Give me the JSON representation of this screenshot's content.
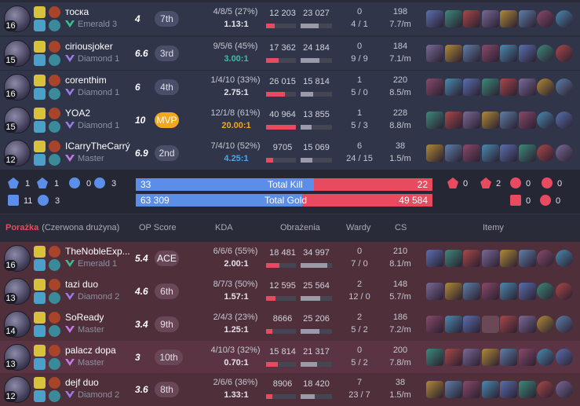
{
  "team_blue": {
    "players": [
      {
        "name": "тоска",
        "level": "16",
        "rank": "Emerald 3",
        "rank_color": "#36c28c",
        "op_score": "4",
        "placement": "7th",
        "placement_style": "normal",
        "kda_line": "4/8/5 (27%)",
        "kda_ratio": "1.13:1",
        "kda_color": "#e4e4ea",
        "damage_dealt": "12 203",
        "damage_taken": "23 027",
        "damage_dealt_pct": 0.29,
        "damage_taken_pct": 0.57,
        "wards_placed": "0",
        "wards_line": "4 / 1",
        "cs": "198",
        "cs_per_min": "7.7/m"
      },
      {
        "name": "ciriousjoker",
        "level": "15",
        "rank": "Diamond 1",
        "rank_color": "#9a7be8",
        "op_score": "6.6",
        "placement": "3rd",
        "placement_style": "normal",
        "kda_line": "9/5/6 (45%)",
        "kda_ratio": "3.00:1",
        "kda_color": "#2ec4a6",
        "damage_dealt": "17 362",
        "damage_taken": "24 184",
        "damage_dealt_pct": 0.42,
        "damage_taken_pct": 0.6,
        "wards_placed": "0",
        "wards_line": "9 / 9",
        "cs": "184",
        "cs_per_min": "7.1/m"
      },
      {
        "name": "corenthim",
        "level": "16",
        "rank": "Diamond 1",
        "rank_color": "#9a7be8",
        "op_score": "6",
        "placement": "4th",
        "placement_style": "normal",
        "kda_line": "1/4/10 (33%)",
        "kda_ratio": "2.75:1",
        "kda_color": "#e4e4ea",
        "damage_dealt": "26 015",
        "damage_taken": "15 814",
        "damage_dealt_pct": 0.64,
        "damage_taken_pct": 0.39,
        "wards_placed": "1",
        "wards_line": "5 / 0",
        "cs": "220",
        "cs_per_min": "8.5/m"
      },
      {
        "name": "YOA2",
        "level": "15",
        "rank": "Diamond 1",
        "rank_color": "#9a7be8",
        "op_score": "10",
        "placement": "MVP",
        "placement_style": "mvp",
        "kda_line": "12/1/8 (61%)",
        "kda_ratio": "20.00:1",
        "kda_color": "#f0a81e",
        "damage_dealt": "40 964",
        "damage_taken": "13 855",
        "damage_dealt_pct": 1.0,
        "damage_taken_pct": 0.34,
        "wards_placed": "1",
        "wards_line": "5 / 3",
        "cs": "228",
        "cs_per_min": "8.8/m"
      },
      {
        "name": "ICarryTheCarrý",
        "level": "12",
        "rank": "Master",
        "rank_color": "#c47ae8",
        "op_score": "6.9",
        "placement": "2nd",
        "placement_style": "normal",
        "kda_line": "7/4/10 (52%)",
        "kda_ratio": "4.25:1",
        "kda_color": "#4aa8f0",
        "damage_dealt": "9705",
        "damage_taken": "15 069",
        "damage_dealt_pct": 0.24,
        "damage_taken_pct": 0.37,
        "wards_placed": "6",
        "wards_line": "24 / 15",
        "cs": "38",
        "cs_per_min": "1.5/m"
      }
    ]
  },
  "summary": {
    "blue_objectives": [
      "1",
      "1",
      "0",
      "3"
    ],
    "blue_objectives_row2": [
      "11",
      "3"
    ],
    "red_objectives": [
      "0",
      "2",
      "0",
      "0"
    ],
    "red_objectives_row2": [
      "0",
      "0"
    ],
    "total_kill_label": "Total Kill",
    "total_kill_blue": "33",
    "total_kill_red": "22",
    "total_kill_blue_share": 0.6,
    "total_gold_label": "Total Gold",
    "total_gold_blue": "63 309",
    "total_gold_red": "49 584",
    "total_gold_blue_share": 0.56
  },
  "team_red": {
    "result_label": "Porażka",
    "team_label": "(Czerwona drużyna)",
    "headers": {
      "op_score": "OP Score",
      "kda": "KDA",
      "damage": "Obrażenia",
      "wards": "Wardy",
      "cs": "CS",
      "items": "Itemy"
    },
    "players": [
      {
        "name": "TheNobleExp...",
        "level": "16",
        "rank": "Emerald 1",
        "rank_color": "#36c28c",
        "op_score": "5.4",
        "placement": "ACE",
        "placement_style": "ace",
        "kda_line": "6/6/6 (55%)",
        "kda_ratio": "2.00:1",
        "kda_color": "#e4e4ea",
        "damage_dealt": "18 481",
        "damage_taken": "34 997",
        "damage_dealt_pct": 0.45,
        "damage_taken_pct": 0.85,
        "wards_placed": "0",
        "wards_line": "7 / 0",
        "cs": "210",
        "cs_per_min": "8.1/m"
      },
      {
        "name": "tazi duo",
        "level": "13",
        "rank": "Diamond 2",
        "rank_color": "#9a7be8",
        "op_score": "4.6",
        "placement": "6th",
        "placement_style": "normal",
        "kda_line": "8/7/3 (50%)",
        "kda_ratio": "1.57:1",
        "kda_color": "#e4e4ea",
        "damage_dealt": "12 595",
        "damage_taken": "25 564",
        "damage_dealt_pct": 0.31,
        "damage_taken_pct": 0.62,
        "wards_placed": "2",
        "wards_line": "12 / 0",
        "cs": "148",
        "cs_per_min": "5.7/m"
      },
      {
        "name": "SoReady",
        "level": "14",
        "rank": "Master",
        "rank_color": "#c47ae8",
        "op_score": "3.4",
        "placement": "9th",
        "placement_style": "normal",
        "kda_line": "2/4/3 (23%)",
        "kda_ratio": "1.25:1",
        "kda_color": "#e4e4ea",
        "damage_dealt": "8666",
        "damage_taken": "25 206",
        "damage_dealt_pct": 0.21,
        "damage_taken_pct": 0.61,
        "wards_placed": "2",
        "wards_line": "5 / 2",
        "cs": "186",
        "cs_per_min": "7.2/m"
      },
      {
        "name": "palacz dopa",
        "level": "13",
        "rank": "Master",
        "rank_color": "#c47ae8",
        "op_score": "3",
        "placement": "10th",
        "placement_style": "normal",
        "kda_line": "4/10/3 (32%)",
        "kda_ratio": "0.70:1",
        "kda_color": "#e4e4ea",
        "damage_dealt": "15 814",
        "damage_taken": "21 317",
        "damage_dealt_pct": 0.39,
        "damage_taken_pct": 0.52,
        "wards_placed": "0",
        "wards_line": "5 / 2",
        "cs": "200",
        "cs_per_min": "7.8/m"
      },
      {
        "name": "dejf duo",
        "level": "12",
        "rank": "Diamond 2",
        "rank_color": "#9a7be8",
        "op_score": "3.6",
        "placement": "8th",
        "placement_style": "normal",
        "kda_line": "2/6/6 (36%)",
        "kda_ratio": "1.33:1",
        "kda_color": "#e4e4ea",
        "damage_dealt": "8906",
        "damage_taken": "18 420",
        "damage_dealt_pct": 0.22,
        "damage_taken_pct": 0.45,
        "wards_placed": "7",
        "wards_line": "23 / 7",
        "cs": "38",
        "cs_per_min": "1.5/m"
      }
    ]
  },
  "colors": {
    "blue": "#5a8ee8",
    "red": "#e84a5f",
    "damage_bar": "#e84a5f",
    "taken_bar": "#9a9aa8"
  }
}
